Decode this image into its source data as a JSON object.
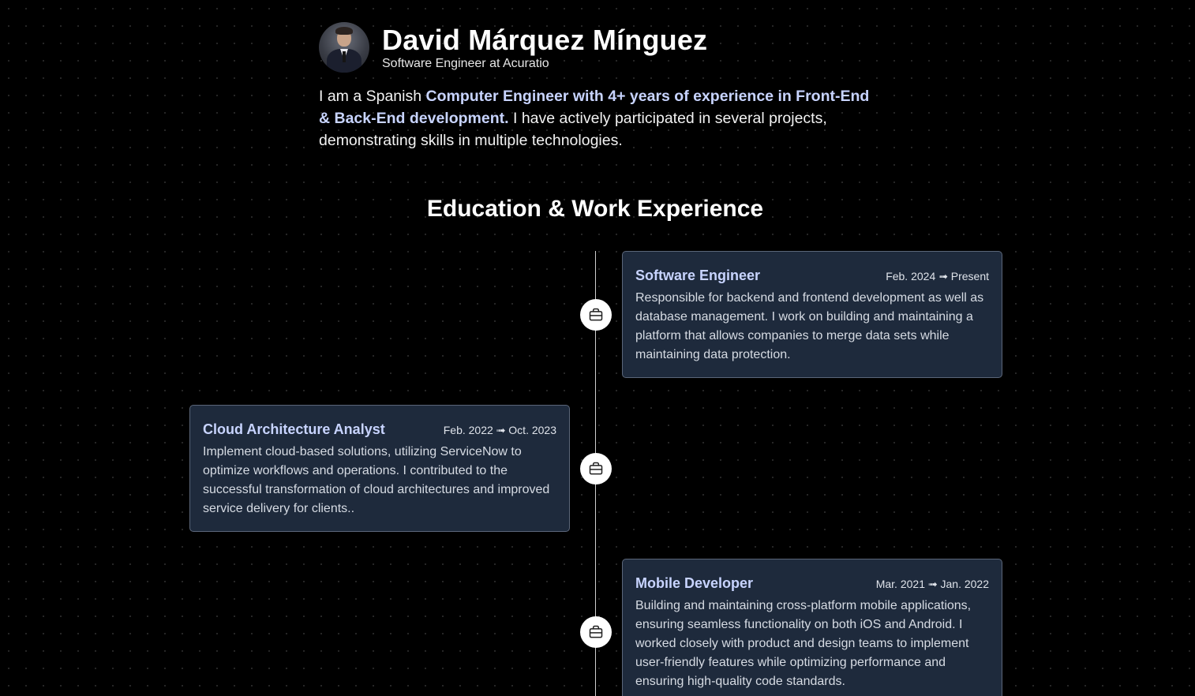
{
  "profile": {
    "name": "David Márquez Mínguez",
    "role": "Software Engineer at Acuratio"
  },
  "intro": {
    "part1": "I am a Spanish ",
    "highlight": "Computer Engineer with 4+ years of experience in Front-End & Back-End development.",
    "part2": " I have actively participated in several projects, demonstrating skills in multiple technologies."
  },
  "section": {
    "title": "Education & Work Experience"
  },
  "timeline": {
    "node_icon": "briefcase-icon",
    "entries": [
      {
        "title": "Software Engineer",
        "date": "Feb. 2024 ➟ Present",
        "description": "Responsible for backend and frontend development as well as database management. I work on building and maintaining a platform that allows companies to merge data sets while maintaining data protection."
      },
      {
        "title": "Cloud Architecture Analyst",
        "date": "Feb. 2022 ➟ Oct. 2023",
        "description": "Implement cloud-based solutions, utilizing ServiceNow to optimize workflows and operations. I contributed to the successful transformation of cloud architectures and improved service delivery for clients.."
      },
      {
        "title": "Mobile Developer",
        "date": "Mar. 2021 ➟ Jan. 2022",
        "description": "Building and maintaining cross-platform mobile applications, ensuring seamless functionality on both iOS and Android. I worked closely with product and design teams to implement user-friendly features while optimizing performance and ensuring high-quality code standards."
      }
    ]
  },
  "colors": {
    "background": "#000000",
    "accent": "#c8d4ff",
    "card_bg": "#1e2a3c"
  }
}
